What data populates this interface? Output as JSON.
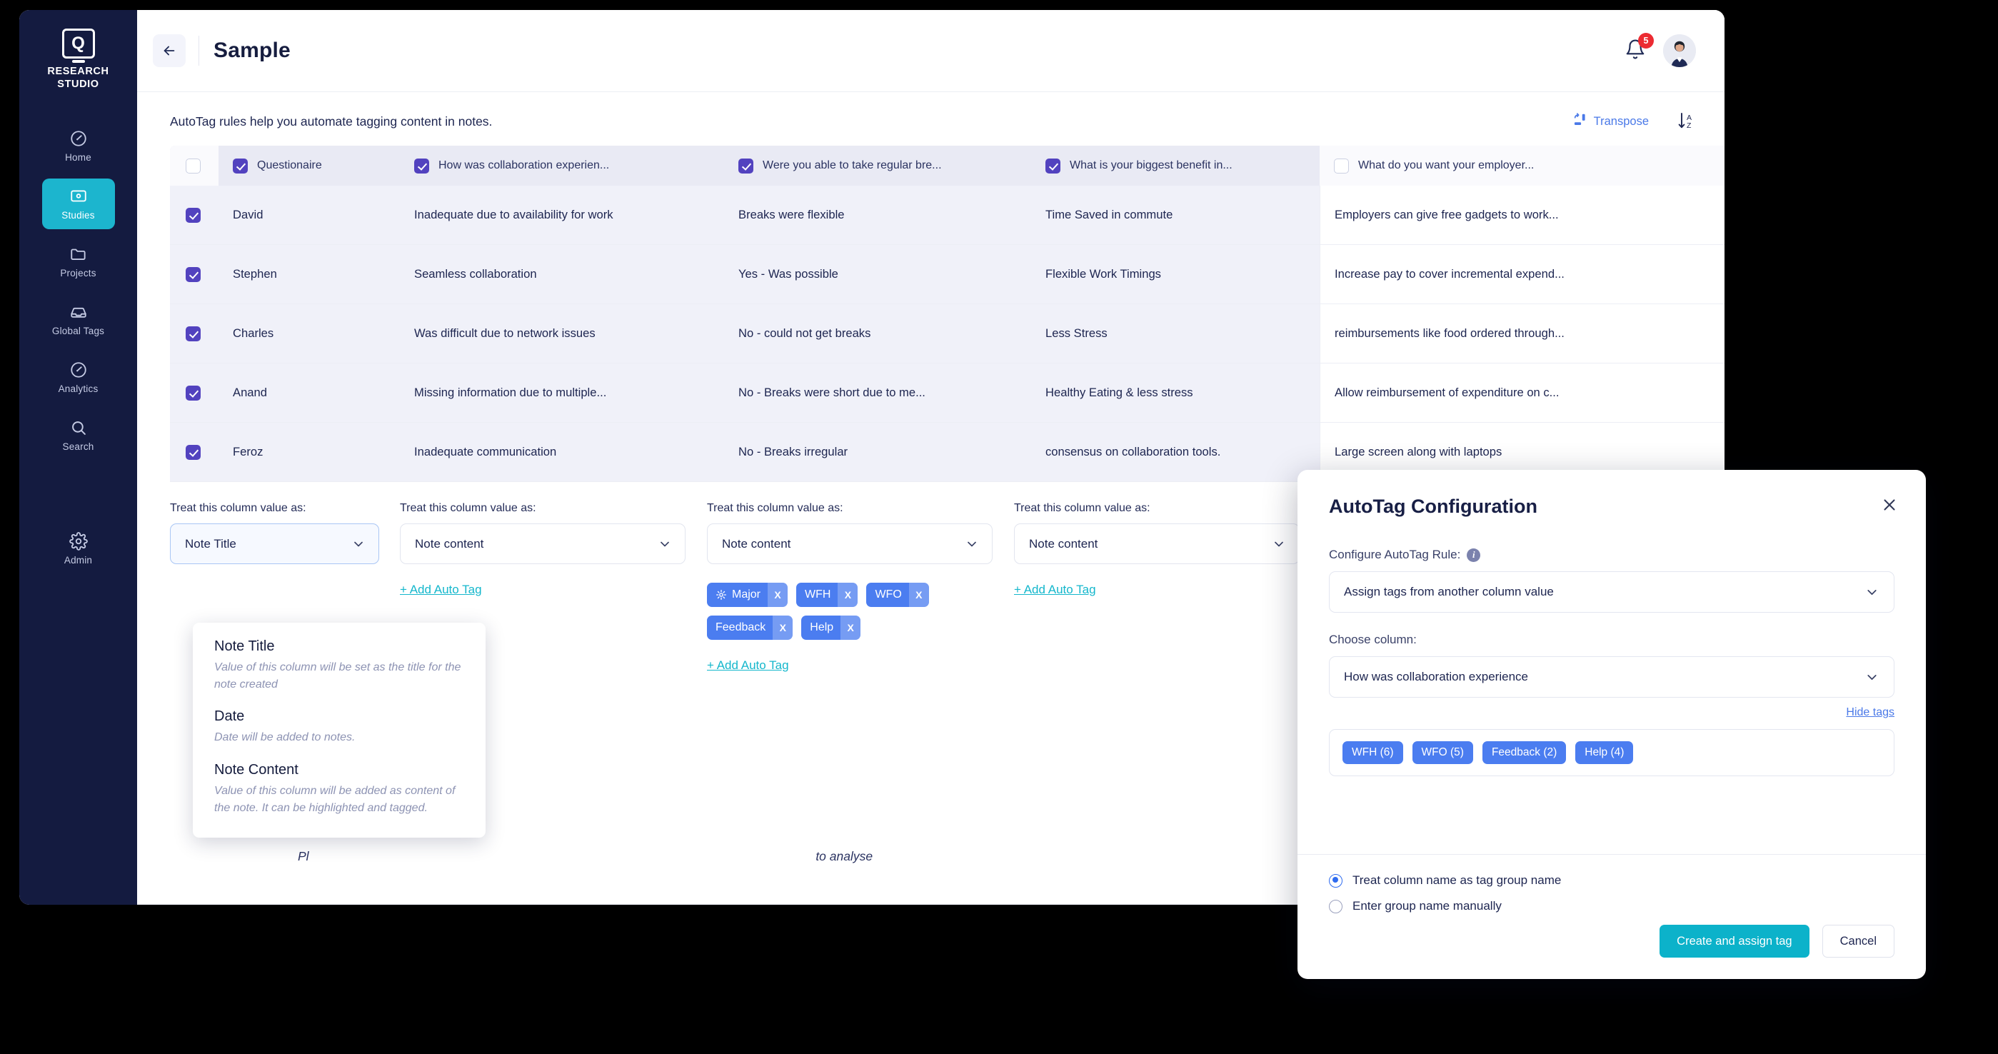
{
  "sidebar": {
    "brand_name": "RESEARCH\nSTUDIO",
    "brand_line1": "RESEARCH",
    "brand_line2": "STUDIO",
    "items": [
      {
        "label": "Home",
        "icon": "speedometer-icon",
        "active": false
      },
      {
        "label": "Studies",
        "icon": "study-card-icon",
        "active": true
      },
      {
        "label": "Projects",
        "icon": "folder-icon",
        "active": false
      },
      {
        "label": "Global Tags",
        "icon": "tags-tray-icon",
        "active": false
      },
      {
        "label": "Analytics",
        "icon": "speedometer-icon",
        "active": false
      },
      {
        "label": "Search",
        "icon": "search-icon",
        "active": false
      },
      {
        "label": "Admin",
        "icon": "gear-icon",
        "active": false
      }
    ],
    "active_color": "#1cb5ce",
    "background_color": "#141b40"
  },
  "topbar": {
    "back_label": "back",
    "title": "Sample",
    "notification_count": "5"
  },
  "subheader": {
    "description": "AutoTag rules help you automate tagging content in notes.",
    "transpose_label": "Transpose",
    "sort_label": "sort-a-z"
  },
  "table": {
    "headers": [
      {
        "label": "Questionaire",
        "checked": true
      },
      {
        "label": "How was collaboration experien...",
        "checked": true
      },
      {
        "label": "Were you able to take regular bre...",
        "checked": true
      },
      {
        "label": "What is your biggest benefit in...",
        "checked": true
      },
      {
        "label": "What do you want your employer...",
        "checked": false
      }
    ],
    "select_all_checked": false,
    "rows": [
      {
        "checked": true,
        "cells": [
          "David",
          "Inadequate due to availability for work",
          "Breaks were flexible",
          "Time Saved in commute",
          "Employers can give free gadgets to work..."
        ]
      },
      {
        "checked": true,
        "cells": [
          "Stephen",
          "Seamless collaboration",
          "Yes - Was possible",
          "Flexible Work Timings",
          "Increase pay to cover incremental expend..."
        ]
      },
      {
        "checked": true,
        "cells": [
          "Charles",
          "Was difficult due to network issues",
          "No - could not get breaks",
          "Less Stress",
          "reimbursements like food ordered through..."
        ]
      },
      {
        "checked": true,
        "cells": [
          "Anand",
          "Missing information due to multiple...",
          "No - Breaks were short due to me...",
          "Healthy Eating & less stress",
          "Allow reimbursement of expenditure on c..."
        ]
      },
      {
        "checked": true,
        "cells": [
          "Feroz",
          "Inadequate communication",
          "No - Breaks irregular",
          "consensus on collaboration tools.",
          "Large screen along with laptops"
        ]
      }
    ]
  },
  "column_config": {
    "label": "Treat this column value as:",
    "columns": [
      {
        "value": "Note Title",
        "add_tag_label": "+ Add Auto Tag",
        "tags": []
      },
      {
        "value": "Note content",
        "add_tag_label": "+ Add Auto Tag",
        "tags": []
      },
      {
        "value": "Note content",
        "add_tag_label": "+ Add Auto Tag",
        "tags": [
          {
            "label": "Major",
            "has_gear": true,
            "remove": "X"
          },
          {
            "label": "WFH",
            "has_gear": false,
            "remove": "X"
          },
          {
            "label": "WFO",
            "has_gear": false,
            "remove": "X"
          },
          {
            "label": "Feedback",
            "has_gear": false,
            "remove": "X"
          },
          {
            "label": "Help",
            "has_gear": false,
            "remove": "X"
          }
        ]
      },
      {
        "value": "Note content",
        "add_tag_label": "+ Add Auto Tag",
        "tags": []
      }
    ]
  },
  "dropdown": {
    "options": [
      {
        "title": "Note Title",
        "description": "Value of this column will be set as the title for the note created"
      },
      {
        "title": "Date",
        "description": "Date will be added to notes."
      },
      {
        "title": "Note Content",
        "description": "Value of this column will be added as content of the note. It can be highlighted and tagged."
      }
    ]
  },
  "footer": {
    "note_left": "Pl",
    "note_right": "to analyse"
  },
  "modal": {
    "title": "AutoTag Configuration",
    "close_label": "close",
    "rule_label": "Configure AutoTag Rule:",
    "rule_value": "Assign tags from another column value",
    "column_label": "Choose column:",
    "column_value": "How was collaboration experience",
    "hide_tags_label": "Hide tags",
    "tags": [
      {
        "label": "WFH (6)"
      },
      {
        "label": "WFO (5)"
      },
      {
        "label": "Feedback (2)"
      },
      {
        "label": "Help (4)"
      }
    ],
    "options": [
      {
        "label": "Treat column name as tag group name",
        "selected": true
      },
      {
        "label": "Enter group name manually",
        "selected": false
      }
    ],
    "primary_button": "Create and assign tag",
    "secondary_button": "Cancel"
  },
  "colors": {
    "sidebar_bg": "#141b40",
    "accent_teal": "#1cb5ce",
    "tag_blue": "#4b7df0",
    "checkbox_purple": "#5242bf",
    "link_blue": "#4a79e8",
    "badge_red": "#ec2b32"
  }
}
